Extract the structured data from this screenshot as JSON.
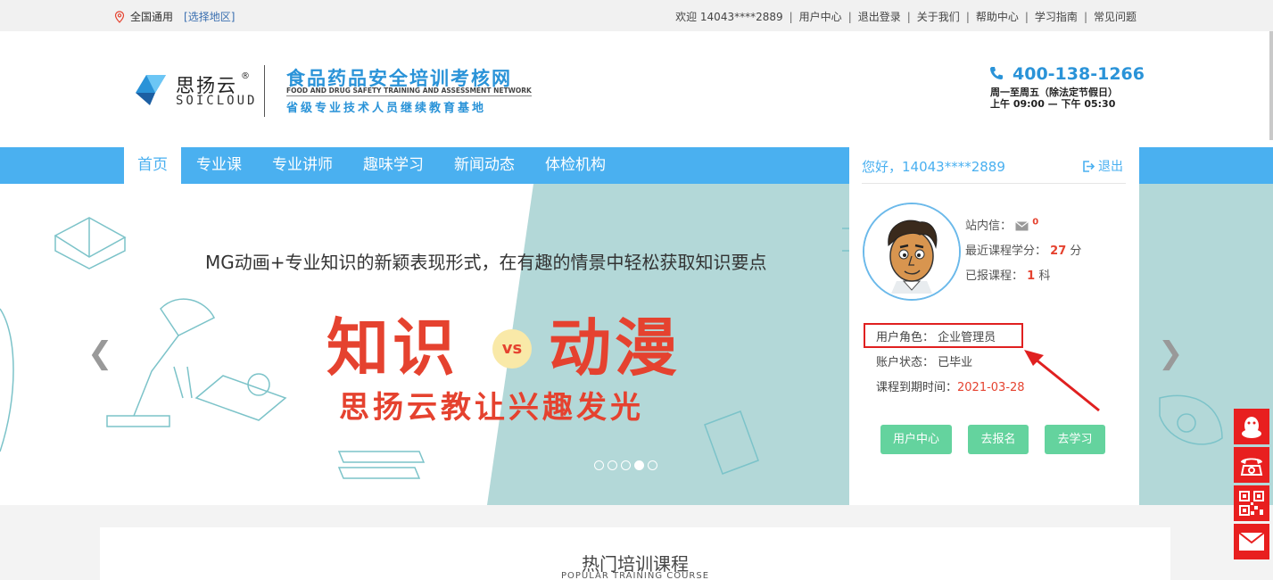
{
  "topbar": {
    "location": "全国通用",
    "region_link": "[选择地区]",
    "welcome": "欢迎 14043****2889",
    "links": [
      "用户中心",
      "退出登录",
      "关于我们",
      "帮助中心",
      "学习指南",
      "常见问题"
    ]
  },
  "header": {
    "logo_cn": "思扬云",
    "logo_reg": "®",
    "logo_en": "SOICLOUD",
    "site_title": "食品药品安全培训考核网",
    "site_en": "FOOD AND DRUG SAFETY TRAINING AND ASSESSMENT NETWORK",
    "site_sub": "省级专业技术人员继续教育基地",
    "phone": "400-138-1266",
    "hours_line1": "周一至周五（除法定节假日）",
    "hours_line2": "上午 09:00 — 下午 05:30"
  },
  "nav": {
    "items": [
      "首页",
      "专业课",
      "专业讲师",
      "趣味学习",
      "新闻动态",
      "体检机构"
    ],
    "active": "首页"
  },
  "banner": {
    "tagline": "MG动画+专业知识的新颖表现形式，在有趣的情景中轻松获取知识要点",
    "left_word": "知识",
    "vs": "vs",
    "right_word": "动漫",
    "slogan": "思扬云教让兴趣发光",
    "slide_count": 5,
    "active_slide": 4
  },
  "panel": {
    "hello": "您好，14043****2889",
    "logout": "退出",
    "mail_label": "站内信：",
    "mail_count": "0",
    "credit_label": "最近课程学分：",
    "credit_value": "27",
    "credit_unit": "分",
    "courses_label": "已报课程：",
    "courses_value": "1",
    "courses_unit": "科",
    "role": "用户角色： 企业管理员",
    "status": "账户状态： 已毕业",
    "expire_label": "课程到期时间：",
    "expire_value": "2021-03-28",
    "buttons": [
      "用户中心",
      "去报名",
      "去学习"
    ]
  },
  "hot": {
    "title": "热门培训课程",
    "subtitle": "POPULAR TRAINING COURSE"
  },
  "colors": {
    "brand_blue": "#4ab0f0",
    "accent_red": "#e5422f",
    "button_green": "#64d39e",
    "float_red": "#e81f1f"
  }
}
